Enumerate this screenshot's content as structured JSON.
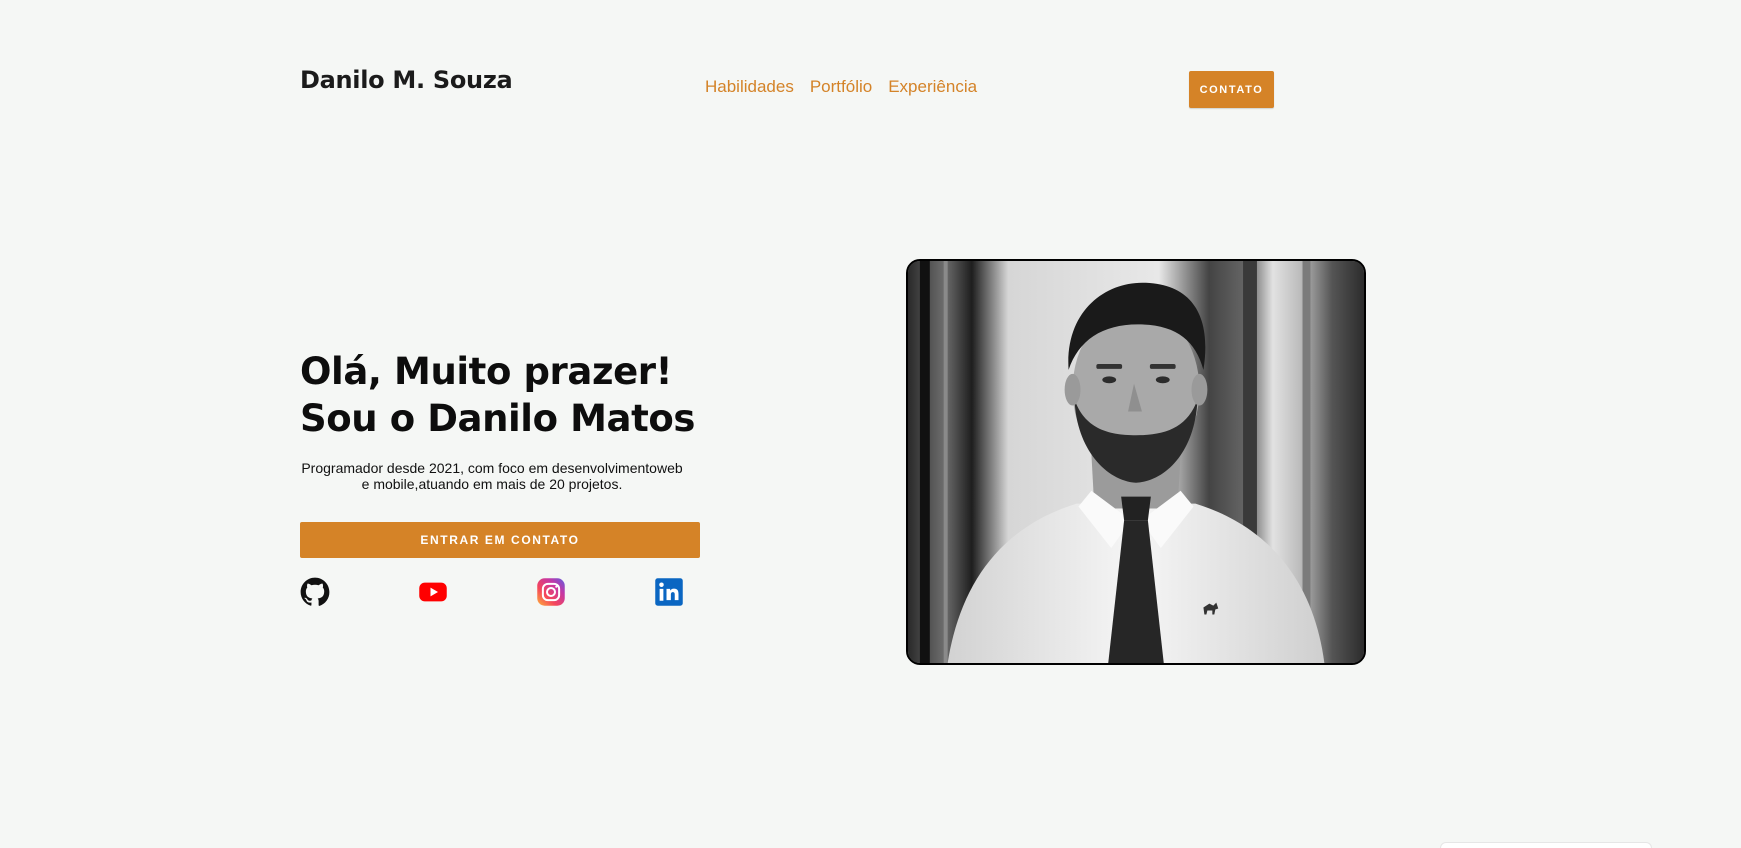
{
  "header": {
    "brand": "Danilo M. Souza",
    "nav": [
      {
        "label": "Habilidades"
      },
      {
        "label": "Portfólio"
      },
      {
        "label": "Experiência"
      }
    ],
    "contact_button": "CONTATO"
  },
  "hero": {
    "title_line1": "Olá, Muito prazer!",
    "title_line2": "Sou o Danilo Matos",
    "description": "Programador desde 2021, com foco em desenvolvimentoweb e mobile,atuando em mais de 20 projetos.",
    "cta_button": "ENTRAR EM CONTATO",
    "social": [
      {
        "icon": "github-icon"
      },
      {
        "icon": "youtube-icon"
      },
      {
        "icon": "instagram-icon"
      },
      {
        "icon": "linkedin-icon"
      }
    ]
  },
  "colors": {
    "accent": "#d58327",
    "background": "#f5f7f5",
    "text": "#111111"
  }
}
